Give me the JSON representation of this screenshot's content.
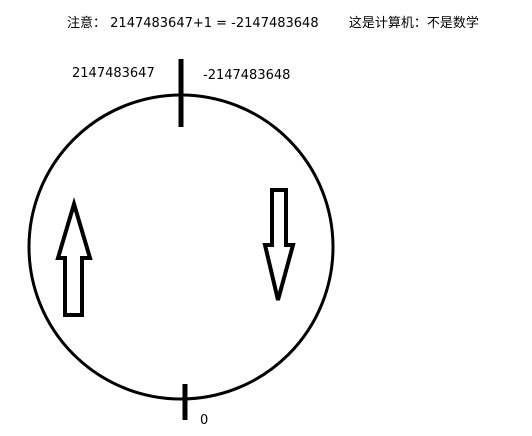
{
  "note": {
    "prefix": "注意：",
    "equation": "2147483647+1 = -2147483648",
    "comment": "这是计算机：不是数学"
  },
  "labels": {
    "max_value": "2147483647",
    "min_value": "-2147483648",
    "zero": "0"
  },
  "colors": {
    "stroke": "#000000",
    "background": "#ffffff"
  }
}
